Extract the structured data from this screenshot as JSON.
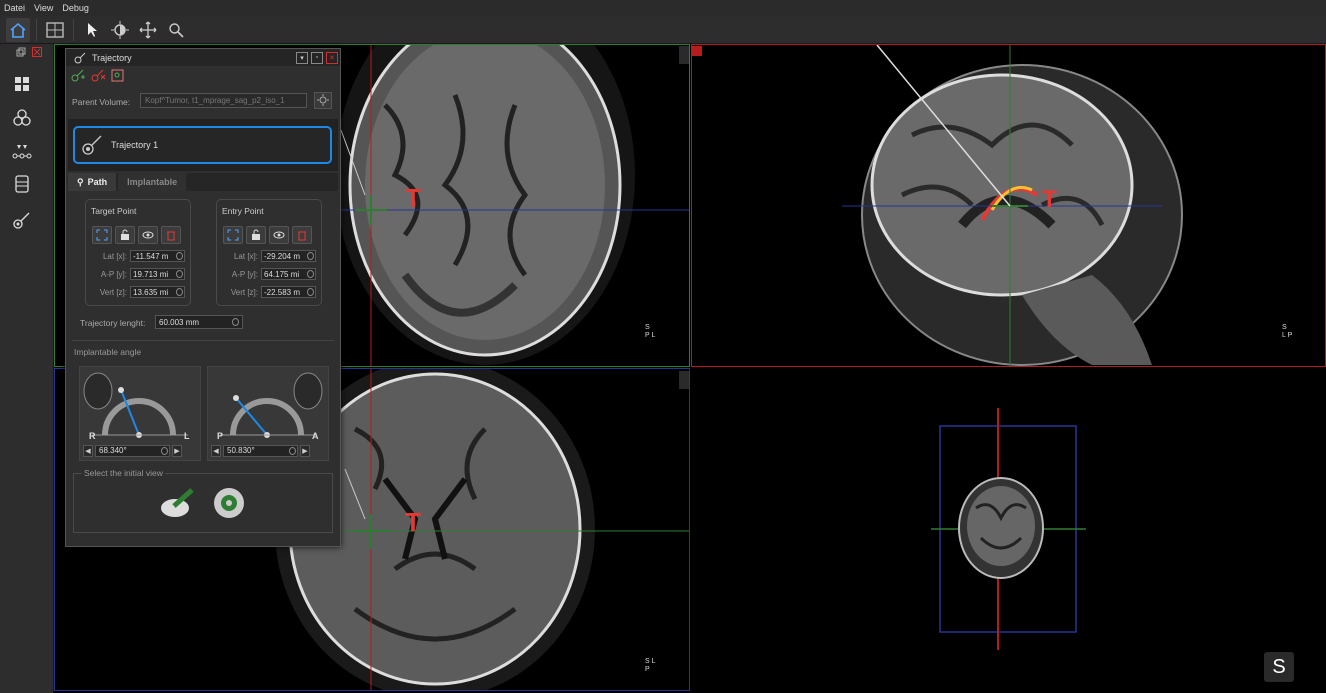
{
  "menu": [
    "Datei",
    "View",
    "Debug"
  ],
  "panel": {
    "title": "Trajectory",
    "parent_volume_label": "Parent Volume:",
    "parent_volume_value": "Kopf^Tumor, t1_mprage_sag_p2_iso_1",
    "trajectory_name": "Trajectory 1",
    "tabs": [
      "Path",
      "Implantable"
    ],
    "target": {
      "title": "Target Point",
      "lat_label": "Lat [x]:",
      "lat": "-11.547 m",
      "ap_label": "A-P [y]:",
      "ap": "19.713 mi",
      "vert_label": "Vert [z]:",
      "vert": "13.635 mi"
    },
    "entry": {
      "title": "Entry Point",
      "lat_label": "Lat [x]:",
      "lat": "-29.204 m",
      "ap_label": "A-P [y]:",
      "ap": "64.175 mi",
      "vert_label": "Vert [z]:",
      "vert": "-22.583 m"
    },
    "trajectory_length_label": "Trajectory lenght:",
    "trajectory_length": "60.003 mm",
    "implantable_angle_label": "Implantable angle",
    "angle1": {
      "left": "R",
      "right": "L",
      "value": "68.340°"
    },
    "angle2": {
      "left": "P",
      "right": "A",
      "value": "50.830°"
    },
    "initial_view_label": "Select the initial view"
  },
  "viewports": {
    "coronal_orient": [
      "S",
      "P  L"
    ],
    "sagittal_orient": [
      "S",
      "L  P"
    ],
    "axial_orient": [
      "S  L",
      "P"
    ]
  },
  "badge": "S",
  "colors": {
    "accent": "#1e88e5",
    "green": "#2e7d32",
    "red": "#b71c1c",
    "blue": "#283593"
  }
}
